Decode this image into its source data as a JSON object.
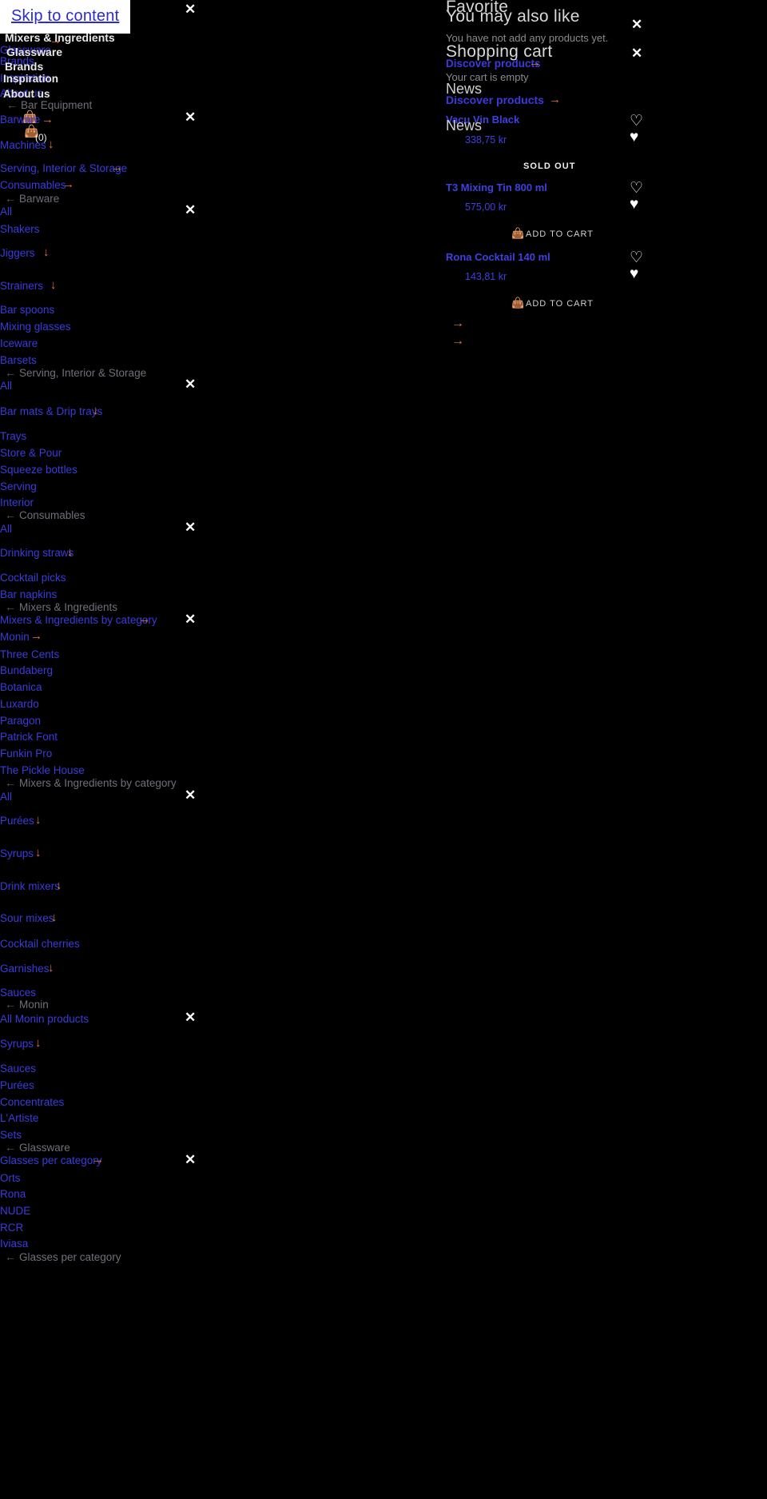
{
  "skip_link": "Skip to content",
  "top_nav": {
    "items": [
      {
        "label": "Mixers & Ingredients",
        "arrow": "→"
      },
      {
        "label": "Glassware",
        "arrow": "→"
      },
      {
        "label": "Brands",
        "arrow": ""
      },
      {
        "label": "Inspiration",
        "arrow": ""
      },
      {
        "label": "About us",
        "arrow": ""
      }
    ],
    "overlay_items": [
      "Mixers & Ingredients",
      "Glassware",
      "Brands",
      "Inspiration",
      "About us"
    ]
  },
  "cart": {
    "count_label": "(0)",
    "bag_icon": "shopping-bag-icon"
  },
  "panels": [
    {
      "back": "Bar Equipment",
      "items": [
        {
          "label": "Barware",
          "arrow": "→"
        },
        {
          "label": "Machines",
          "arrow": "↓"
        },
        {
          "label": "Serving, Interior & Storage",
          "arrow": "→"
        },
        {
          "label": "Consumables",
          "arrow": "→"
        }
      ]
    },
    {
      "back": "Barware",
      "items": [
        {
          "label": "All",
          "arrow": ""
        },
        {
          "label": "Shakers",
          "arrow": ""
        },
        {
          "label": "Jiggers",
          "arrow": "↓"
        },
        {
          "label": "Strainers",
          "arrow": "↓"
        },
        {
          "label": "Bar spoons",
          "arrow": ""
        },
        {
          "label": "Mixing glasses",
          "arrow": ""
        },
        {
          "label": "Iceware",
          "arrow": ""
        },
        {
          "label": "Barsets",
          "arrow": ""
        }
      ]
    },
    {
      "back": "Serving, Interior & Storage",
      "items": [
        {
          "label": "All",
          "arrow": ""
        },
        {
          "label": "Bar mats & Drip trays",
          "arrow": "↓"
        },
        {
          "label": "Trays",
          "arrow": ""
        },
        {
          "label": "Store & Pour",
          "arrow": ""
        },
        {
          "label": "Squeeze bottles",
          "arrow": ""
        },
        {
          "label": "Serving",
          "arrow": ""
        },
        {
          "label": "Interior",
          "arrow": ""
        }
      ]
    },
    {
      "back": "Consumables",
      "items": [
        {
          "label": "All",
          "arrow": ""
        },
        {
          "label": "Drinking straws",
          "arrow": "↓"
        },
        {
          "label": "Cocktail picks",
          "arrow": ""
        },
        {
          "label": "Bar napkins",
          "arrow": ""
        }
      ]
    },
    {
      "back": "Mixers & Ingredients",
      "items": [
        {
          "label": "Mixers & Ingredients by category",
          "arrow": "→"
        },
        {
          "label": "Monin",
          "arrow": "→"
        },
        {
          "label": "Three Cents",
          "arrow": ""
        },
        {
          "label": "Bundaberg",
          "arrow": ""
        },
        {
          "label": "Botanica",
          "arrow": ""
        },
        {
          "label": "Luxardo",
          "arrow": ""
        },
        {
          "label": "Paragon",
          "arrow": ""
        },
        {
          "label": "Patrick Font",
          "arrow": ""
        },
        {
          "label": "Funkin Pro",
          "arrow": ""
        },
        {
          "label": "The Pickle House",
          "arrow": ""
        }
      ]
    },
    {
      "back": "Mixers & Ingredients by category",
      "items": [
        {
          "label": "All",
          "arrow": ""
        },
        {
          "label": "Purées",
          "arrow": "↓"
        },
        {
          "label": "Syrups",
          "arrow": "↓"
        },
        {
          "label": "Drink mixers",
          "arrow": "↓"
        },
        {
          "label": "Sour mixes",
          "arrow": "↓"
        },
        {
          "label": "Cocktail cherries",
          "arrow": ""
        },
        {
          "label": "Garnishes",
          "arrow": "↓"
        },
        {
          "label": "Sauces",
          "arrow": ""
        }
      ]
    },
    {
      "back": "Monin",
      "items": [
        {
          "label": "All Monin products",
          "arrow": ""
        },
        {
          "label": "Syrups",
          "arrow": "↓"
        },
        {
          "label": "Sauces",
          "arrow": ""
        },
        {
          "label": "Purées",
          "arrow": ""
        },
        {
          "label": "Concentrates",
          "arrow": ""
        },
        {
          "label": "L'Artiste",
          "arrow": ""
        },
        {
          "label": "Sets",
          "arrow": ""
        }
      ]
    },
    {
      "back": "Glassware",
      "items": [
        {
          "label": "Glasses per category",
          "arrow": "→"
        },
        {
          "label": "Orts",
          "arrow": ""
        },
        {
          "label": "Rona",
          "arrow": ""
        },
        {
          "label": "NUDE",
          "arrow": ""
        },
        {
          "label": "RCR",
          "arrow": ""
        },
        {
          "label": "Iviasa",
          "arrow": ""
        }
      ]
    },
    {
      "back": "Glasses per category",
      "items": []
    }
  ],
  "right": {
    "favorite_title": "Favorite",
    "you_may_also_like": "You may also like",
    "empty_favorite": "You have not add any products yet.",
    "shopping_cart_title": "Shopping cart",
    "discover_products_1": "Discover products",
    "cart_empty": "Your cart is empty",
    "news_title_1": "News",
    "discover_products_2": "Discover products",
    "news_title_2": "News",
    "arrow": "→",
    "sold_out_label": "SOLD OUT",
    "add_to_cart_label": "ADD TO CART",
    "products": [
      {
        "name": "Vacu Vin Black",
        "price": "338,75 kr",
        "sold_out": true,
        "add_to_cart": false
      },
      {
        "name": "T3 Mixing Tin 800 ml",
        "price": "575,00 kr",
        "sold_out": false,
        "add_to_cart": true
      },
      {
        "name": "Rona Cocktail 140 ml",
        "price": "143,81 kr",
        "sold_out": false,
        "add_to_cart": true
      }
    ]
  },
  "icons": {
    "close": "✕",
    "heart_outline": "♡",
    "heart_filled": "♥",
    "back_arrow": "←",
    "right_arrow": "→",
    "down_arrow": "↓",
    "bag": "shopping-bag-icon"
  },
  "colors": {
    "background": "#000000",
    "link": "#3b3bdd",
    "accent": "#e2714a",
    "text_light": "#e8e8e8"
  }
}
